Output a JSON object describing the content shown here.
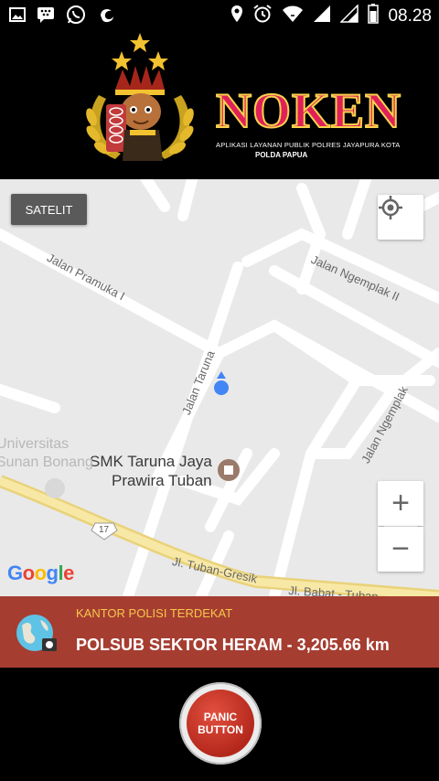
{
  "status_bar": {
    "time": "08.28",
    "icons": [
      "gallery-icon",
      "bbm-icon",
      "whatsapp-icon",
      "uc-browser-icon",
      "location-icon",
      "alarm-icon",
      "wifi-icon",
      "signal-icon",
      "signal-icon-2",
      "battery-icon"
    ]
  },
  "header": {
    "brand": "NOKEN",
    "subtitle": "APLIKASI LAYANAN PUBLIK POLRES JAYAPURA KOTA",
    "region": "POLDA PAPUA",
    "logo": "police-emblem-logo"
  },
  "map": {
    "satelit_label": "SATELIT",
    "zoom_in_label": "+",
    "zoom_out_label": "−",
    "streets": {
      "pramuka": "Jalan Pramuka I",
      "ngemplak2": "Jalan Ngemplak II",
      "taruna": "Jalan Taruna",
      "ngemplak": "Jalan Ngemplak",
      "tuban_gresik": "Jl. Tuban-Gresik",
      "babat_tuban": "Jl. Babat - Tuban",
      "route": "17"
    },
    "poi": {
      "school_line1": "SMK Taruna Jaya",
      "school_line2": "Prawira Tuban",
      "univ_line1": "Universitas",
      "univ_line2": "Sunan Bonang"
    },
    "google": "Google"
  },
  "nearest": {
    "label": "KANTOR POLISI TERDEKAT",
    "value": "POLSUB SEKTOR HERAM - 3,205.66 km"
  },
  "panic": {
    "line1": "PANIC",
    "line2": "BUTTON"
  },
  "colors": {
    "info_bar": "#a63d31",
    "info_label": "#f4c94a",
    "brand": "#e0205a",
    "panic": "#c0342a",
    "road_highlight": "#f5e39a",
    "map_bg": "#e9e9e9"
  }
}
